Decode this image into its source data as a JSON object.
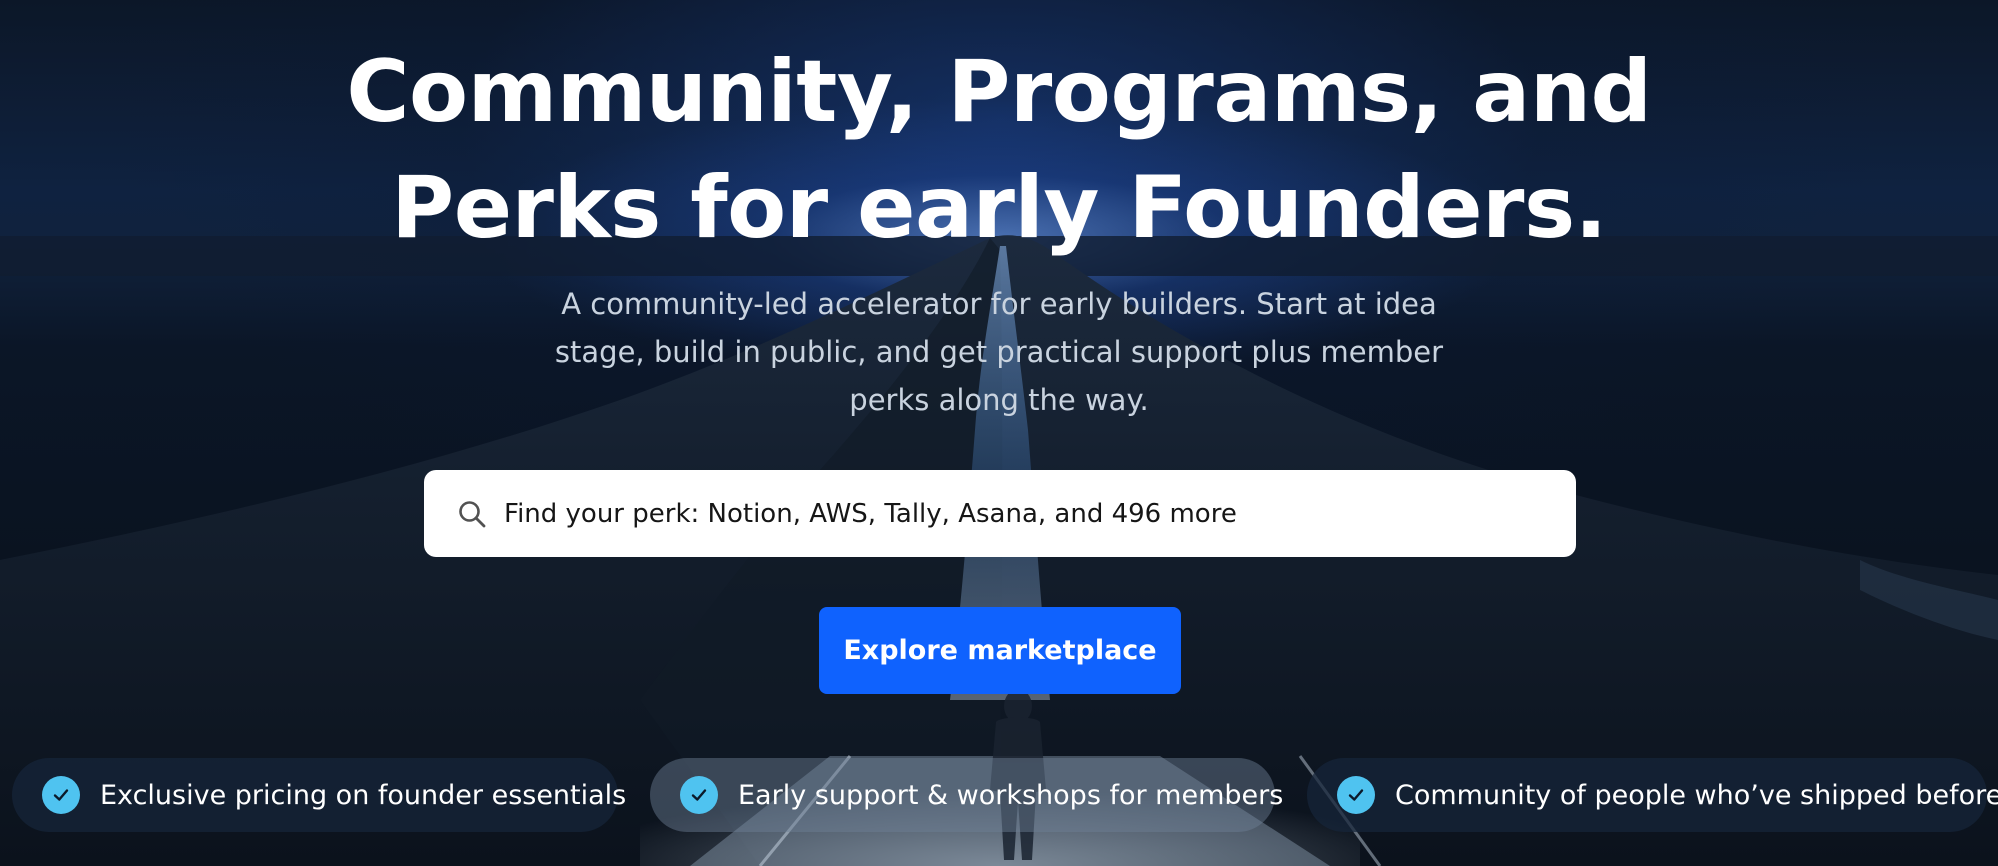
{
  "hero": {
    "headline_line1": "Community, Programs, and",
    "headline_line2": "Perks for early Founders.",
    "subtitle": "A community-led accelerator for early builders. Start at idea stage, build in public, and get practical support plus member perks along the way."
  },
  "search": {
    "placeholder": "Find your perk: Notion, AWS, Tally, Asana, and 496 more",
    "icon": "search-icon"
  },
  "cta": {
    "label": "Explore marketplace",
    "color": "#0f62fe"
  },
  "features": [
    {
      "label": "Exclusive pricing on founder essentials",
      "icon": "check-icon"
    },
    {
      "label": "Early support & workshops for members",
      "icon": "check-icon"
    },
    {
      "label": "Community of people who’ve shipped before",
      "icon": "check-icon"
    }
  ],
  "colors": {
    "accent": "#0f62fe",
    "check": "#4fc3f0",
    "text": "#ffffff",
    "subtitle": "#c9d3df"
  }
}
